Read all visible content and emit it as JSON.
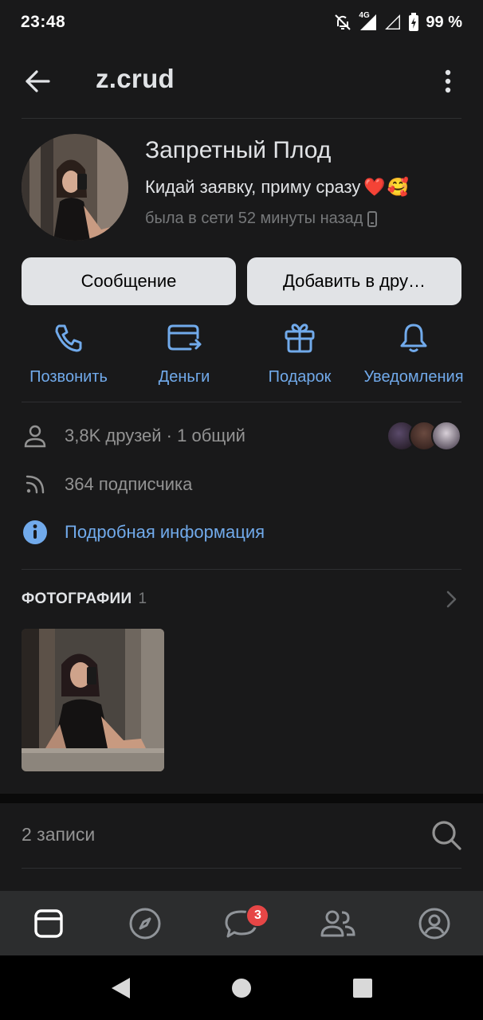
{
  "status_bar": {
    "time": "23:48",
    "network": "4G",
    "battery": "99 %"
  },
  "header": {
    "title": "z.crud",
    "back_icon": "arrow-left-icon",
    "more_icon": "more-vertical-icon"
  },
  "profile": {
    "name": "Запретный Плод",
    "status": "Кидай заявку, приму сразу",
    "status_emoji": [
      "❤️",
      "🥰"
    ],
    "online": "была в сети 52 минуты назад",
    "online_device_icon": "phone-icon"
  },
  "buttons": {
    "message": "Сообщение",
    "add_friend": "Добавить в дру…"
  },
  "actions": [
    {
      "label": "Позвонить",
      "icon": "phone-call-icon"
    },
    {
      "label": "Деньги",
      "icon": "money-transfer-icon"
    },
    {
      "label": "Подарок",
      "icon": "gift-icon"
    },
    {
      "label": "Уведомления",
      "icon": "bell-icon"
    }
  ],
  "info": {
    "friends": "3,8K друзей · 1 общий",
    "followers": "364 подписчика",
    "details": "Подробная информация"
  },
  "photos": {
    "title": "ФОТОГРАФИИ",
    "count": "1"
  },
  "posts": {
    "title": "2 записи"
  },
  "tab_bar": {
    "items": [
      "news-tab-icon",
      "explore-compass-icon",
      "messages-icon",
      "friends-icon",
      "profile-icon"
    ],
    "messages_badge": "3"
  },
  "colors": {
    "background": "#19191a",
    "accent": "#71aaeb",
    "badge": "#e64646",
    "tab_bar": "#2c2d2e"
  }
}
